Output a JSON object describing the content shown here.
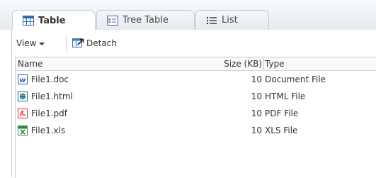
{
  "tabs": [
    {
      "label": "Table",
      "icon": "table-icon",
      "active": true
    },
    {
      "label": "Tree Table",
      "icon": "tree-table-icon",
      "active": false
    },
    {
      "label": "List",
      "icon": "list-icon",
      "active": false
    }
  ],
  "toolbar": {
    "view_label": "View",
    "detach_label": "Detach"
  },
  "table": {
    "columns": [
      "Name",
      "Size (KB)",
      "Type"
    ],
    "rows": [
      {
        "name": "File1.doc",
        "size": "10",
        "type": "Document File",
        "icon": "word-document-icon"
      },
      {
        "name": "File1.html",
        "size": "10",
        "type": "HTML File",
        "icon": "html-file-icon"
      },
      {
        "name": "File1.pdf",
        "size": "10",
        "type": "PDF File",
        "icon": "pdf-file-icon"
      },
      {
        "name": "File1.xls",
        "size": "10",
        "type": "XLS File",
        "icon": "excel-file-icon"
      }
    ]
  },
  "colors": {
    "tab_border": "#c4ccd5",
    "word_blue": "#2a5db0",
    "html_teal": "#1d6f8a",
    "pdf_red": "#d9332b",
    "excel_green": "#2e8b3a"
  }
}
